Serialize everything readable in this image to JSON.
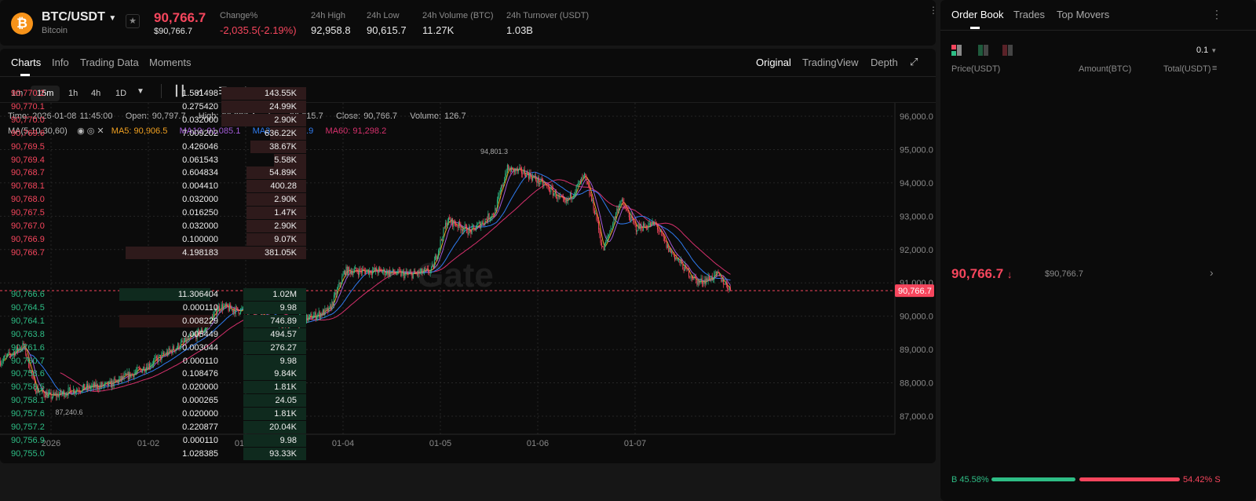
{
  "header": {
    "symbol": "BTC/USDT",
    "name": "Bitcoin",
    "coin_icon": "bitcoin-icon",
    "price": "90,766.7",
    "price_usd": "$90,766.7",
    "stats": [
      {
        "label": "Change%",
        "value": "-2,035.5(-2.19%)"
      },
      {
        "label": "24h High",
        "value": "92,958.8"
      },
      {
        "label": "24h Low",
        "value": "90,615.7"
      },
      {
        "label": "24h Volume (BTC)",
        "value": "11.27K"
      },
      {
        "label": "24h Turnover (USDT)",
        "value": "1.03B"
      }
    ]
  },
  "tabs": [
    "Charts",
    "Info",
    "Trading Data",
    "Moments"
  ],
  "views": [
    "Original",
    "TradingView",
    "Depth"
  ],
  "timeframes": [
    "1m",
    "15m",
    "1h",
    "4h",
    "1D"
  ],
  "ohlc": {
    "time": "Time: 2026-01-08 11:45:00",
    "open": "Open: 90,797.7",
    "high": "High: 90,837.4",
    "low": "Low: 90,615.7",
    "close": "Close: 90,766.7",
    "volume": "Volume: 126.7"
  },
  "ma": {
    "label": "MA(5,10,30,60)",
    "ma5": "MA5: 90,906.5",
    "ma10": "MA10: 91,085.1",
    "ma30": "MA30: 91,158.9",
    "ma60": "MA60: 91,298.2"
  },
  "watermark": "Gate",
  "colors": {
    "up": "#2ebd85",
    "down": "#f6465d",
    "ma5": "#f0a020",
    "ma10": "#a35bd8",
    "ma30": "#2f7bf0",
    "ma60": "#d6306c"
  },
  "chart_data": {
    "type": "candlestick",
    "interval": "15m",
    "ylim": [
      86700,
      96300
    ],
    "yticks": [
      "96,000.0",
      "95,000.0",
      "94,000.0",
      "93,000.0",
      "92,000.0",
      "91,000.0",
      "90,000.0",
      "89,000.0",
      "88,000.0",
      "87,000.0"
    ],
    "ytick_values": [
      96000,
      95000,
      94000,
      93000,
      92000,
      91000,
      90000,
      89000,
      88000,
      87000
    ],
    "xticks": [
      {
        "label": "2026",
        "day": 0
      },
      {
        "label": "01-02",
        "day": 1
      },
      {
        "label": "01-03",
        "day": 2
      },
      {
        "label": "01-04",
        "day": 3
      },
      {
        "label": "01-05",
        "day": 4
      },
      {
        "label": "01-06",
        "day": 5
      },
      {
        "label": "01-07",
        "day": 6
      }
    ],
    "xlim_days": [
      -0.524,
      8.7
    ],
    "approx_close_path_days_price": [
      [
        -0.52,
        88650
      ],
      [
        -0.28,
        89120
      ],
      [
        -0.16,
        87820
      ],
      [
        0,
        87590
      ],
      [
        0.28,
        87820
      ],
      [
        0.6,
        87940
      ],
      [
        0.93,
        88410
      ],
      [
        1.25,
        89000
      ],
      [
        1.57,
        89590
      ],
      [
        1.73,
        90300
      ],
      [
        1.9,
        90180
      ],
      [
        2.14,
        90180
      ],
      [
        2.34,
        89700
      ],
      [
        2.54,
        89830
      ],
      [
        2.86,
        90180
      ],
      [
        3.02,
        91360
      ],
      [
        3.35,
        91360
      ],
      [
        3.67,
        91240
      ],
      [
        3.91,
        91360
      ],
      [
        4.07,
        92890
      ],
      [
        4.31,
        92540
      ],
      [
        4.56,
        93130
      ],
      [
        4.68,
        94420
      ],
      [
        4.88,
        94300
      ],
      [
        5.12,
        93830
      ],
      [
        5.28,
        93360
      ],
      [
        5.48,
        94190
      ],
      [
        5.6,
        93010
      ],
      [
        5.67,
        91950
      ],
      [
        5.85,
        93480
      ],
      [
        6.01,
        92650
      ],
      [
        6.21,
        92770
      ],
      [
        6.33,
        92070
      ],
      [
        6.53,
        91360
      ],
      [
        6.65,
        91010
      ],
      [
        6.85,
        91240
      ],
      [
        6.99,
        90770
      ]
    ],
    "last_price": 90766.7,
    "last_price_label": "90,766.7",
    "annotations": [
      {
        "label": "94,801.3",
        "day": 4.75,
        "price": 94801.3
      },
      {
        "label": "87,240.6",
        "day": -0.02,
        "price": 87240.6
      }
    ]
  },
  "orderbook": {
    "tabs": [
      "Order Book",
      "Trades",
      "Top Movers"
    ],
    "precision": "0.1",
    "cols": [
      "Price(USDT)",
      "Amount(BTC)",
      "Total(USDT)"
    ],
    "asks": [
      [
        "90,770.2",
        "1.581498",
        "143.55K",
        47
      ],
      [
        "90,770.1",
        "0.275420",
        "24.99K",
        47
      ],
      [
        "90,770.0",
        "0.032000",
        "2.90K",
        47
      ],
      [
        "90,769.6",
        "7.009202",
        "636.22K",
        20
      ],
      [
        "90,769.5",
        "0.426046",
        "38.67K",
        31
      ],
      [
        "90,769.4",
        "0.061543",
        "5.58K",
        18
      ],
      [
        "90,768.7",
        "0.604834",
        "54.89K",
        33
      ],
      [
        "90,768.1",
        "0.004410",
        "400.28",
        33
      ],
      [
        "90,768.0",
        "0.032000",
        "2.90K",
        33
      ],
      [
        "90,767.5",
        "0.016250",
        "1.47K",
        33
      ],
      [
        "90,767.0",
        "0.032000",
        "2.90K",
        33
      ],
      [
        "90,766.9",
        "0.100000",
        "9.07K",
        33
      ],
      [
        "90,766.7",
        "4.198183",
        "381.05K",
        100
      ]
    ],
    "mid_price": "90,766.7",
    "mid_usd": "$90,766.7",
    "bids": [
      [
        "90,766.6",
        "11.306404",
        "1.02M",
        100
      ],
      [
        "90,764.5",
        "0.000110",
        "9.98",
        35
      ],
      [
        "90,764.1",
        "0.008229",
        "746.89",
        35
      ],
      [
        "90,763.8",
        "0.005449",
        "494.57",
        35
      ],
      [
        "90,761.6",
        "0.003044",
        "276.27",
        35
      ],
      [
        "90,760.7",
        "0.000110",
        "9.98",
        35
      ],
      [
        "90,758.6",
        "0.108476",
        "9.84K",
        35
      ],
      [
        "90,758.5",
        "0.020000",
        "1.81K",
        35
      ],
      [
        "90,758.1",
        "0.000265",
        "24.05",
        35
      ],
      [
        "90,757.6",
        "0.020000",
        "1.81K",
        35
      ],
      [
        "90,757.2",
        "0.220877",
        "20.04K",
        35
      ],
      [
        "90,756.9",
        "0.000110",
        "9.98",
        35
      ],
      [
        "90,755.0",
        "1.028385",
        "93.33K",
        35
      ]
    ],
    "buy_label": "B 45.58%",
    "sell_label": "54.42% S",
    "buy_ratio": 45.58
  }
}
